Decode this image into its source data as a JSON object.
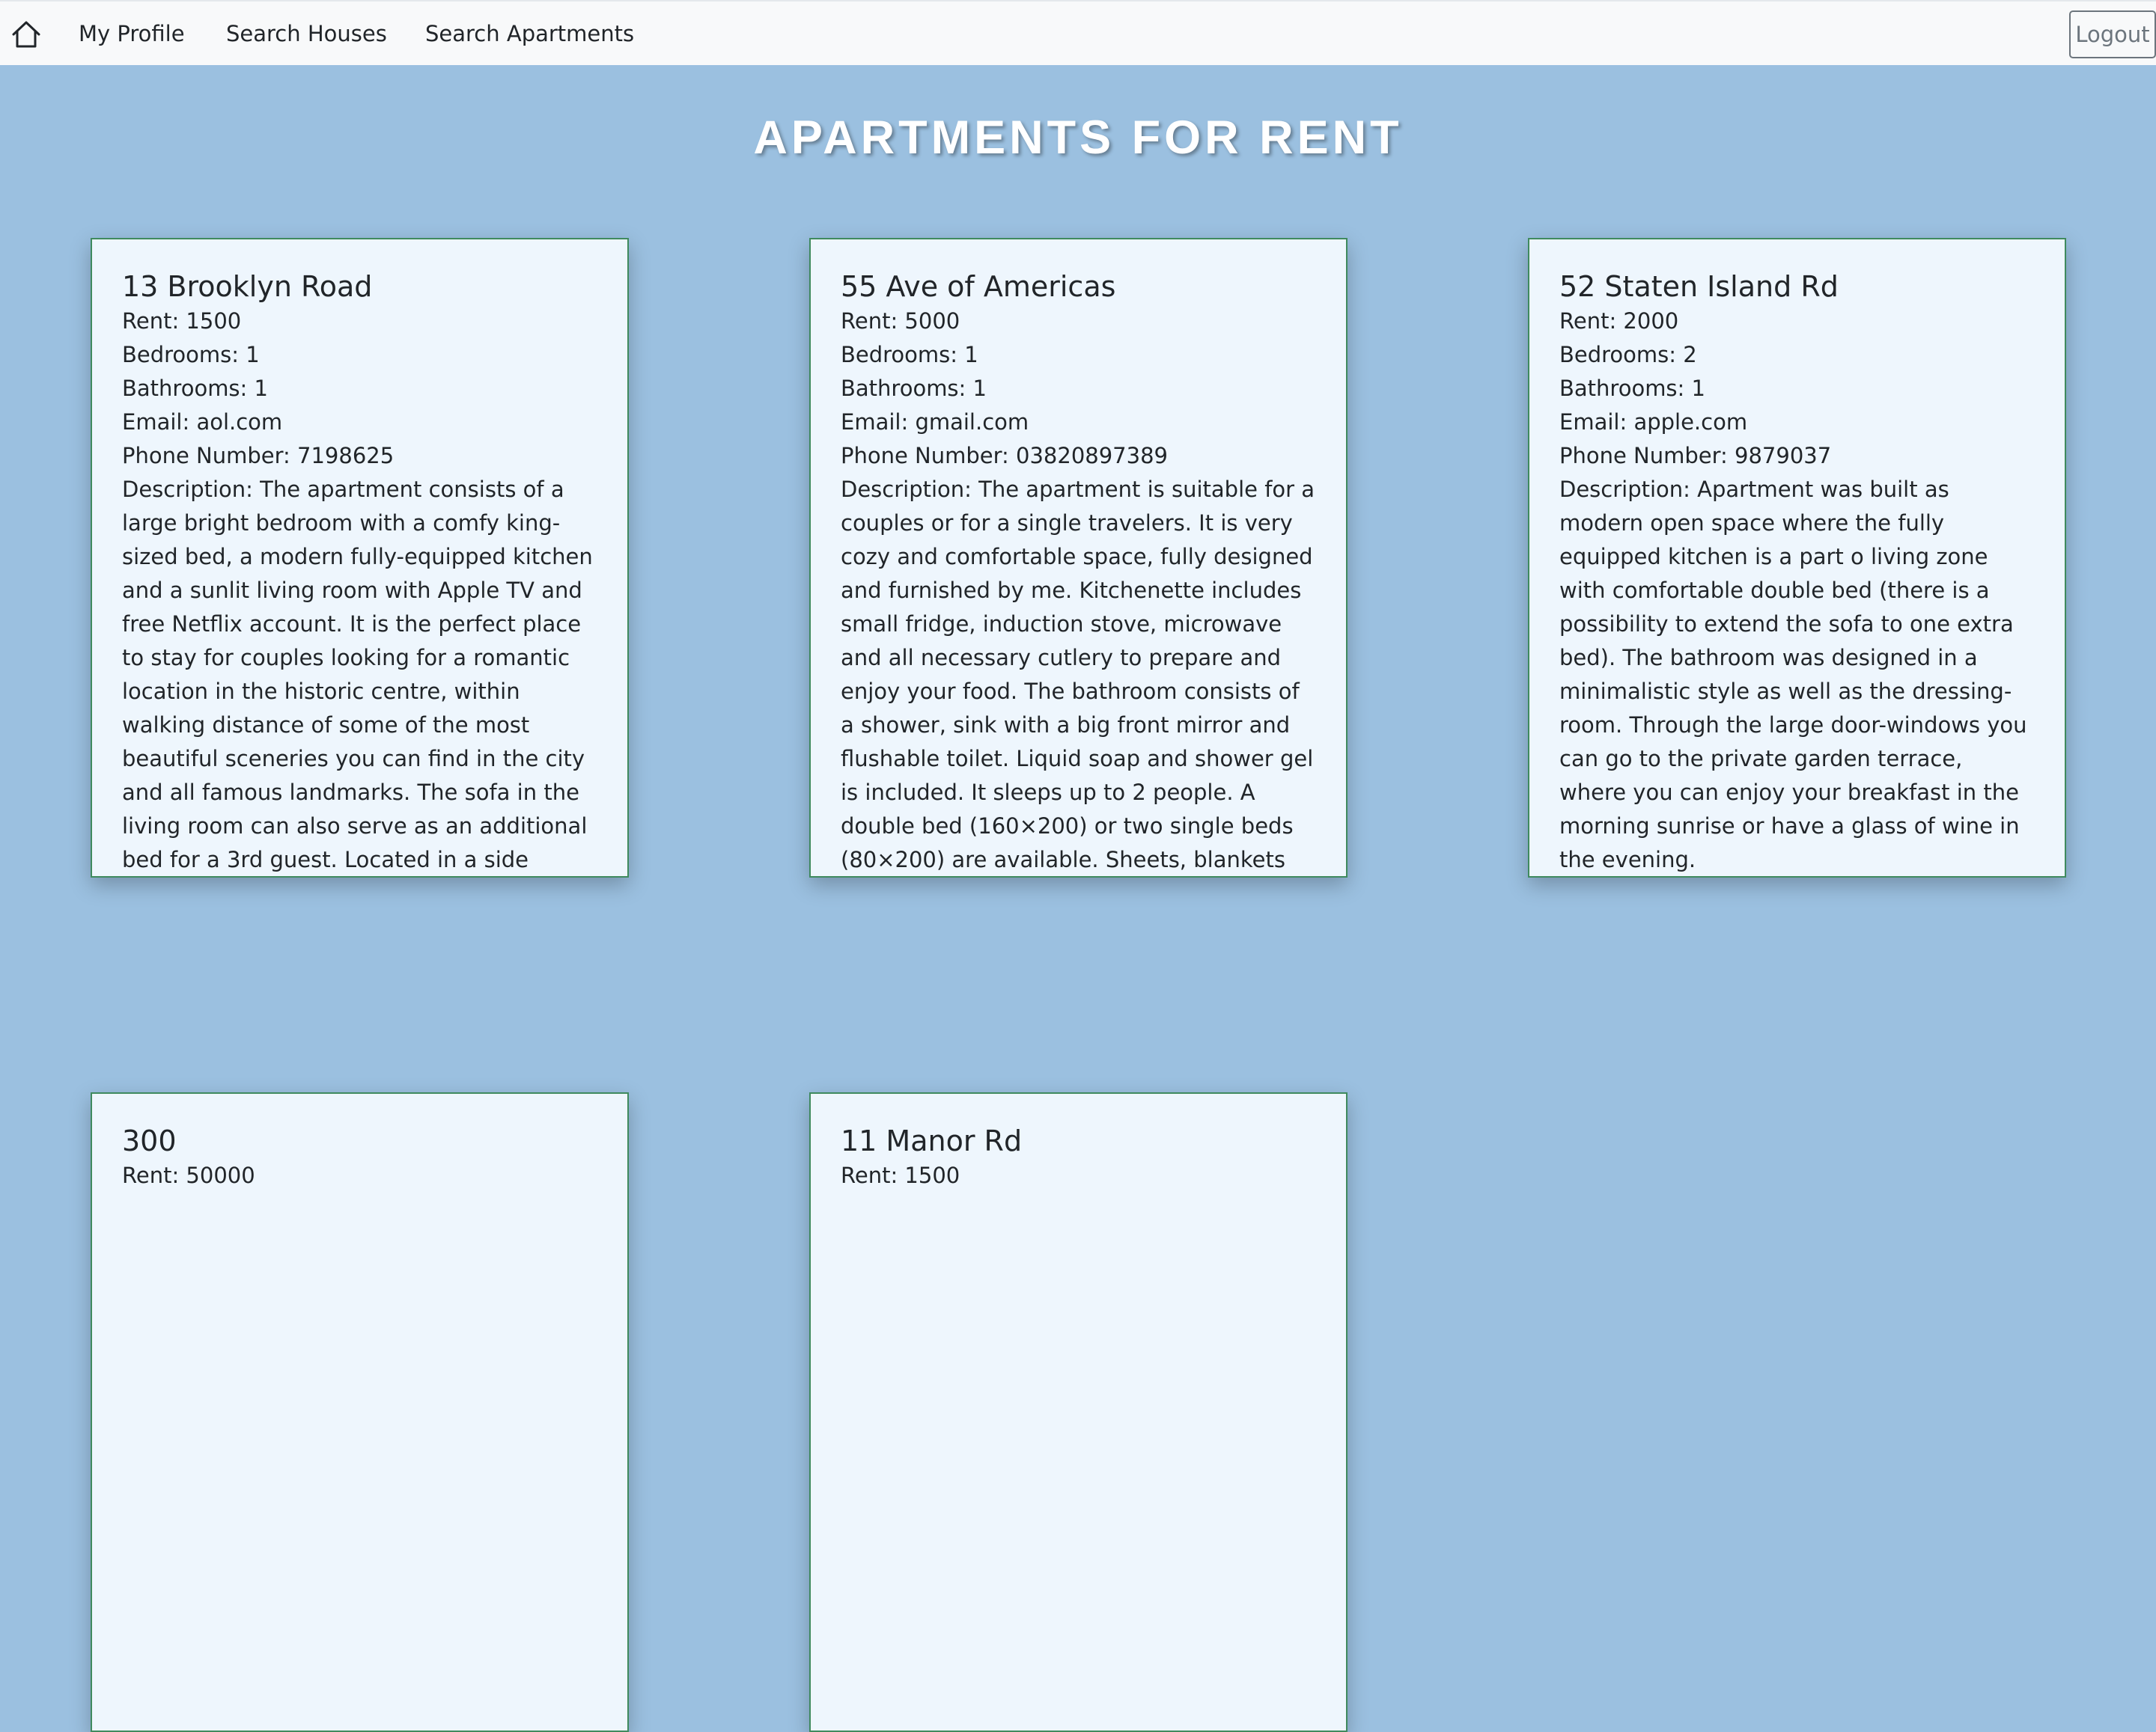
{
  "nav": {
    "home_icon": "home-icon",
    "links": [
      "My Profile",
      "Search Houses",
      "Search Apartments"
    ],
    "logout_label": "Logout"
  },
  "page_title": "APARTMENTS FOR RENT",
  "listings": [
    {
      "title": "13 Brooklyn Road",
      "rent": "Rent: 1500",
      "bedrooms": "Bedrooms: 1",
      "bathrooms": "Bathrooms: 1",
      "email": "Email: aol.com",
      "phone": "Phone Number: 7198625",
      "description": "Description: The apartment consists of a large bright bedroom with a comfy king-sized bed, a modern fully-equipped kitchen and a sunlit living room with Apple TV and free Netflix account. It is the perfect place to stay for couples looking for a romantic location in the historic centre, within walking distance of some of the most beautiful sceneries you can find in the city and all famous landmarks. The sofa in the living room can also serve as an additional bed for a 3rd guest. Located in a side street between the ___ river bank and the"
    },
    {
      "title": "55 Ave of Americas",
      "rent": "Rent: 5000",
      "bedrooms": "Bedrooms: 1",
      "bathrooms": "Bathrooms: 1",
      "email": "Email: gmail.com",
      "phone": "Phone Number: 03820897389",
      "description": "Description: The apartment is suitable for a couples or for a single travelers. It is very cozy and comfortable space, fully designed and furnished by me. Kitchenette includes small fridge, induction stove, microwave and all necessary cutlery to prepare and enjoy your food. The bathroom consists of a shower, sink with a big front mirror and flushable toilet. Liquid soap and shower gel is included. It sleeps up to 2 people. A double bed (160×200) or two single beds (80×200) are available. Sheets, blankets and linen is"
    },
    {
      "title": "52 Staten Island Rd",
      "rent": "Rent: 2000",
      "bedrooms": "Bedrooms: 2",
      "bathrooms": "Bathrooms: 1",
      "email": "Email: apple.com",
      "phone": "Phone Number: 9879037",
      "description": "Description: Apartment was built as modern open space where the fully equipped kitchen is a part o living zone with comfortable double bed (there is a possibility to extend the sofa to one extra bed). The bathroom was designed in a minimalistic style as well as the dressing-room. Through the large door-windows you can go to the private garden terrace, where you can enjoy your breakfast in the morning sunrise or have a glass of wine in the evening."
    },
    {
      "title": "300",
      "rent": "Rent: 50000"
    },
    {
      "title": "11 Manor Rd",
      "rent": "Rent: 1500"
    }
  ]
}
